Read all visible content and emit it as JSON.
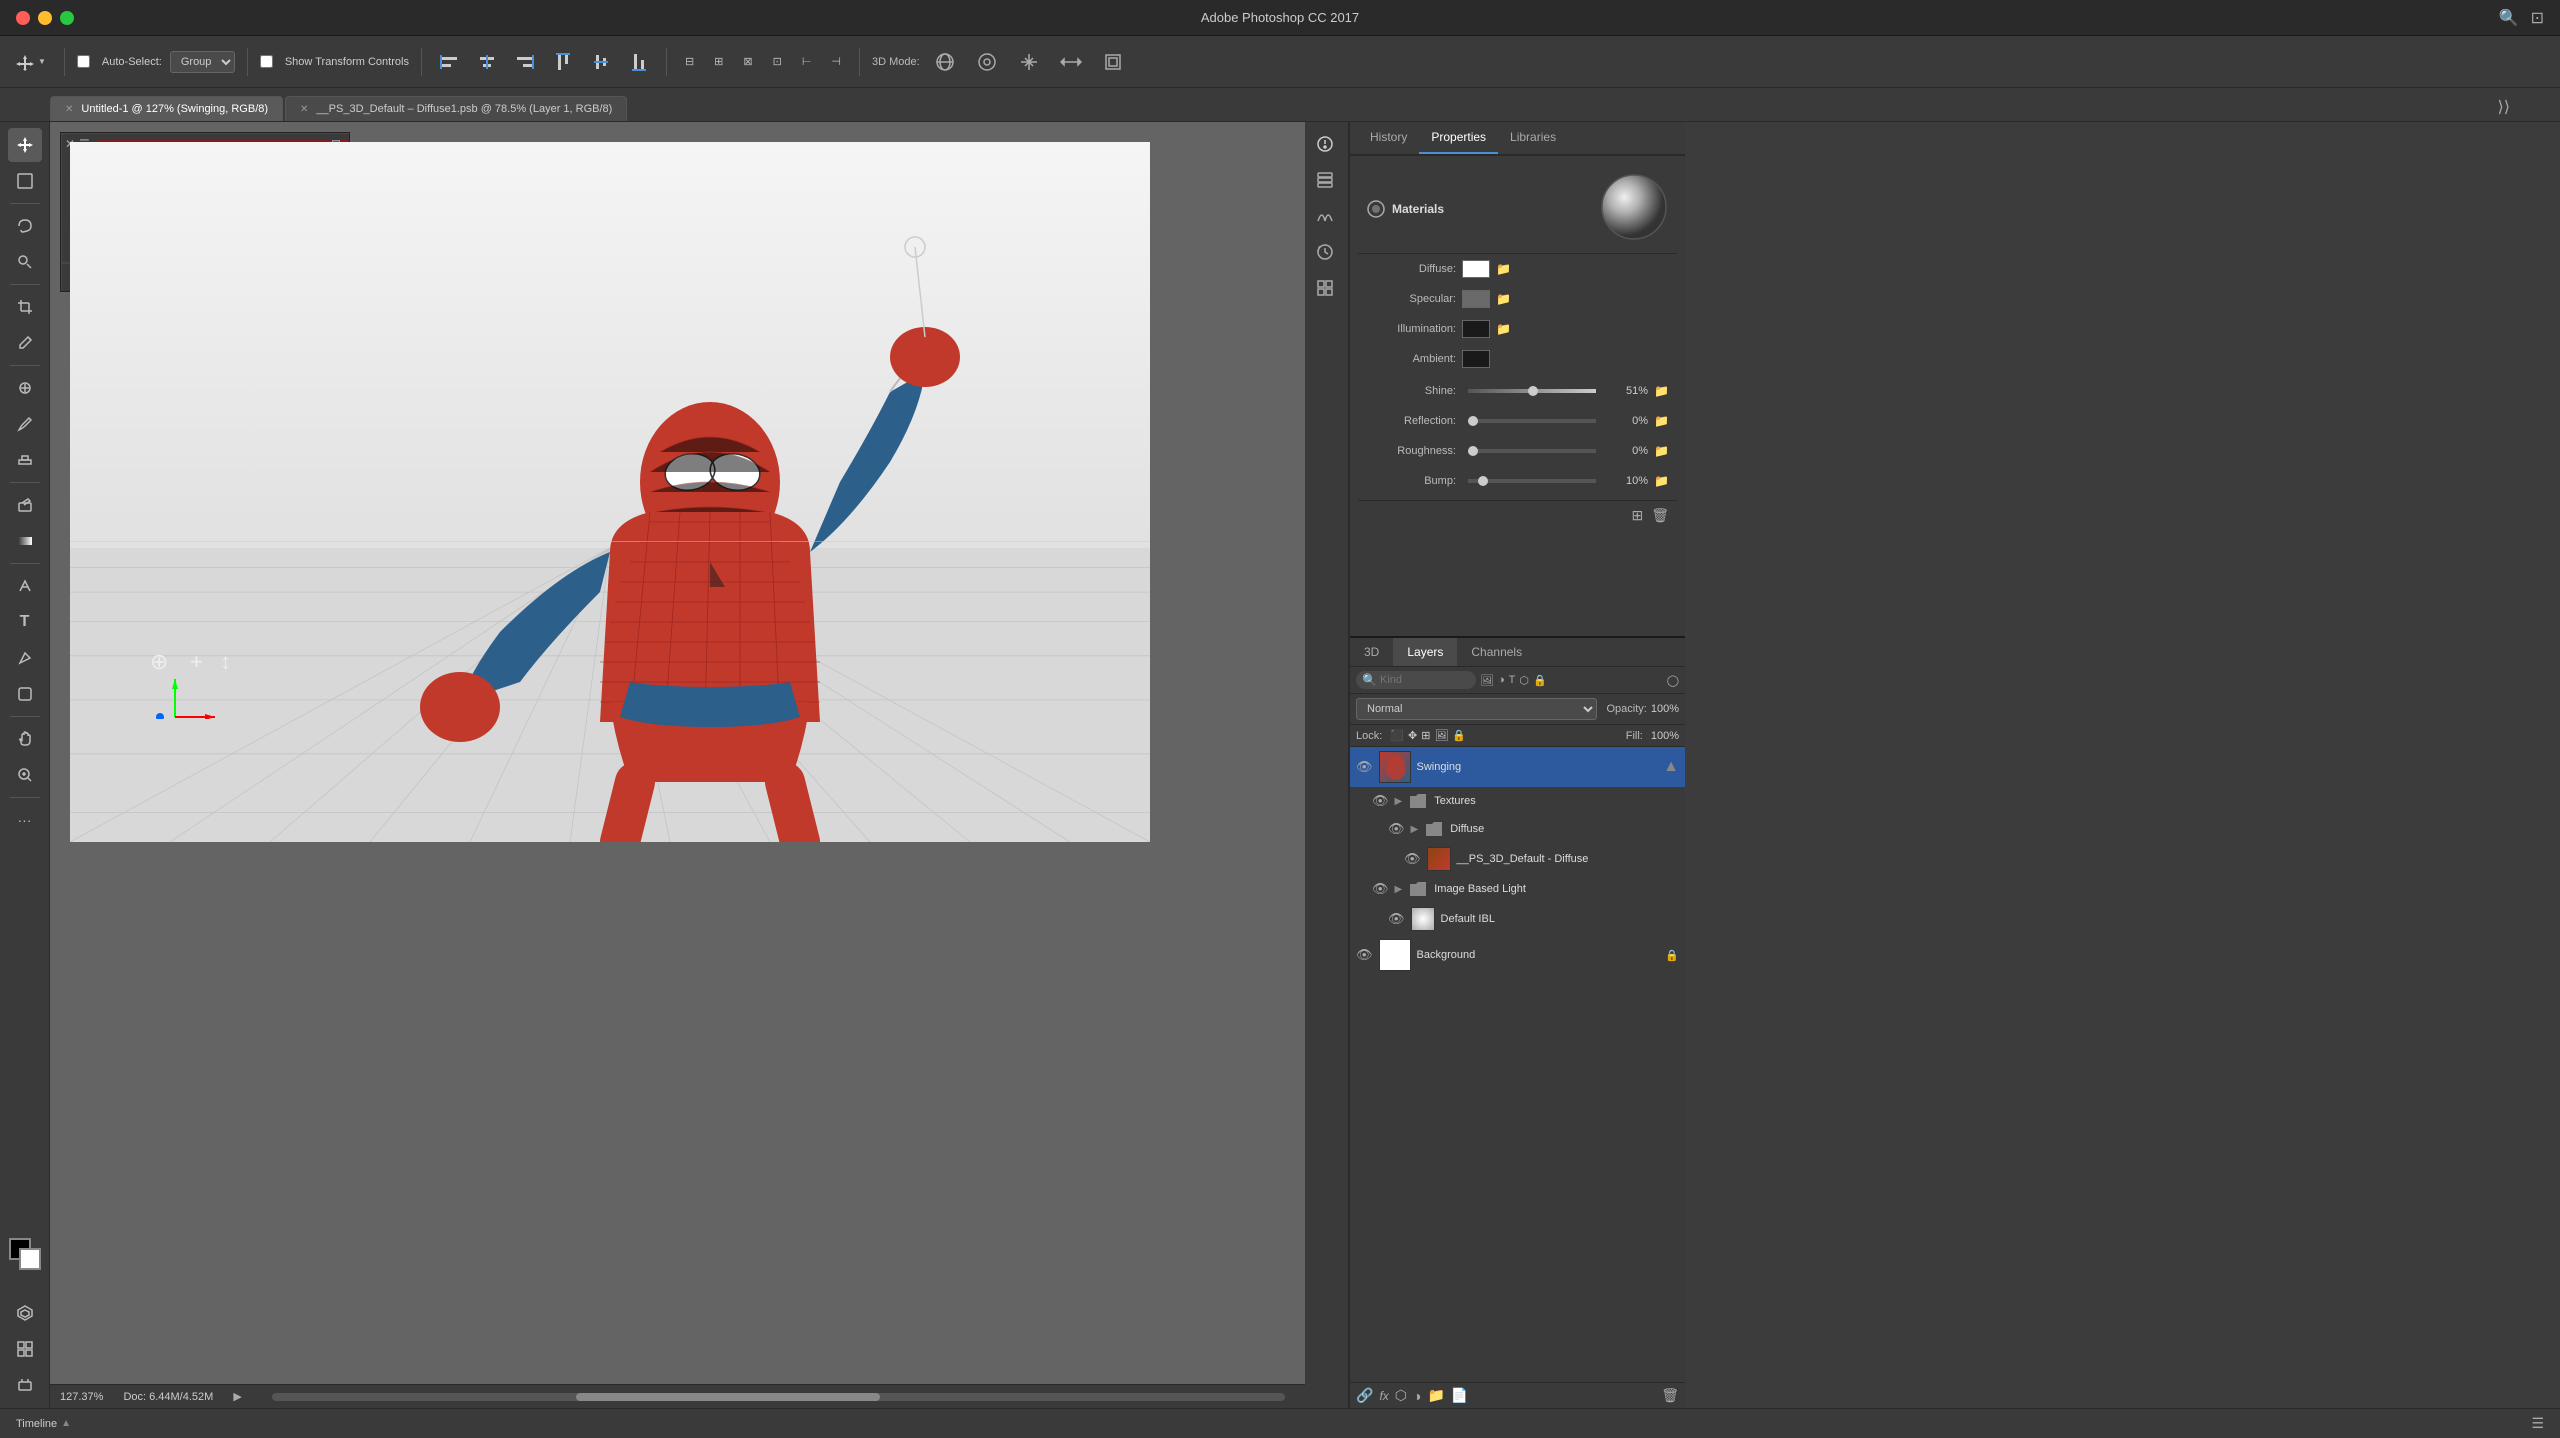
{
  "titlebar": {
    "title": "Adobe Photoshop CC 2017"
  },
  "toolbar": {
    "auto_select_label": "Auto-Select:",
    "group_option": "Group",
    "show_transform_label": "Show Transform Controls",
    "mode_label": "3D Mode:",
    "search_placeholder": "Search"
  },
  "tabs": [
    {
      "label": "Untitled-1 @ 127% (Swinging, RGB/8)",
      "active": true
    },
    {
      "label": "__PS_3D_Default – Diffuse1.psb @ 78.5% (Layer 1, RGB/8)",
      "active": false
    }
  ],
  "panels": {
    "history_label": "History",
    "properties_label": "Properties",
    "libraries_label": "Libraries"
  },
  "materials": {
    "title": "Materials",
    "diffuse_label": "Diffuse:",
    "specular_label": "Specular:",
    "illumination_label": "Illumination:",
    "ambient_label": "Ambient:",
    "shine_label": "Shine:",
    "shine_value": "51%",
    "reflection_label": "Reflection:",
    "reflection_value": "0%",
    "roughness_label": "Roughness:",
    "roughness_value": "0%",
    "bump_label": "Bump:",
    "bump_value": "10%"
  },
  "layers": {
    "label": "Layers",
    "channels_label": "Channels",
    "3d_label": "3D",
    "kind_placeholder": "Kind",
    "blend_mode": "Normal",
    "opacity_label": "Opacity:",
    "opacity_value": "100%",
    "fill_label": "Fill:",
    "fill_value": "100%",
    "lock_label": "Lock:",
    "items": [
      {
        "name": "Swinging",
        "type": "3d",
        "visible": true,
        "active": true
      },
      {
        "name": "Textures",
        "type": "group",
        "visible": true,
        "indent": 1
      },
      {
        "name": "Diffuse",
        "type": "layer",
        "visible": true,
        "indent": 2
      },
      {
        "name": "__PS_3D_Default - Diffuse",
        "type": "layer",
        "visible": true,
        "indent": 3
      },
      {
        "name": "Image Based Light",
        "type": "group",
        "visible": true,
        "indent": 1
      },
      {
        "name": "Default IBL",
        "type": "layer",
        "visible": true,
        "indent": 2
      },
      {
        "name": "Background",
        "type": "background",
        "visible": true,
        "indent": 0
      }
    ]
  },
  "status": {
    "zoom": "127.37%",
    "doc": "Doc: 6.44M/4.52M"
  },
  "timeline": {
    "label": "Timeline"
  },
  "icons": {
    "move": "⊹",
    "marquee": "⬜",
    "lasso": "⊂",
    "quick_select": "⊙",
    "crop": "⊡",
    "eyedropper": "✒",
    "spot_heal": "⊕",
    "brush": "✏",
    "stamp": "⊙",
    "eraser": "◻",
    "gradient": "▬",
    "dodge": "◯",
    "pen": "✑",
    "text": "T",
    "path": "▷",
    "shape": "◻",
    "hand": "✋",
    "zoom": "🔍",
    "more": "•••"
  }
}
